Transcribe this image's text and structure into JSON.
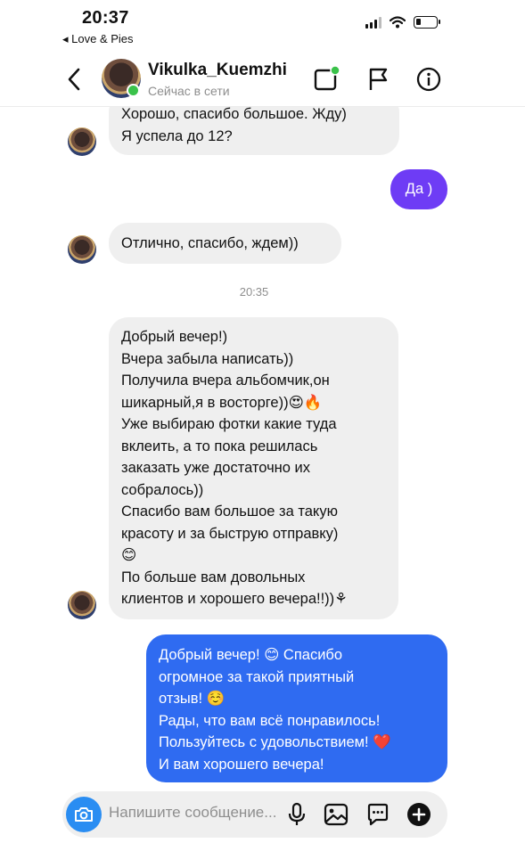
{
  "status_bar": {
    "time": "20:37",
    "back_app": "◂ Love & Pies",
    "icons": [
      "signal-icon",
      "wifi-icon",
      "battery-icon"
    ]
  },
  "header": {
    "username": "Vikulka_Kuemzhi",
    "presence": "Сейчас в сети",
    "icons": [
      "back-chevron-icon",
      "video-call-icon",
      "flag-icon",
      "info-icon"
    ]
  },
  "messages": [
    {
      "direction": "incoming",
      "lines": [
        "Хорошо, спасибо большое.  Жду)",
        "Я успела  до 12?"
      ]
    },
    {
      "direction": "outgoing",
      "lines": [
        "Да )"
      ]
    },
    {
      "direction": "incoming",
      "lines": [
        "Отлично, спасибо, ждем))"
      ]
    },
    {
      "timestamp": "20:35"
    },
    {
      "direction": "incoming",
      "lines": [
        "Добрый вечер!)",
        "Вчера забыла написать))",
        "Получила вчера альбомчик,он",
        "шикарный,я в восторге))😍🔥",
        "Уже выбираю фотки какие туда",
        "вклеить, а то пока решилась",
        "заказать уже  достаточно  их",
        "собралось))",
        "Спасибо  вам большое  за такую",
        "красоту и за быструю отправку)",
        "😊",
        "По больше вам довольных",
        "клиентов  и хорошего вечера!!))⚘"
      ]
    },
    {
      "direction": "outgoing",
      "lines": [
        "Добрый вечер! 😊 Спасибо",
        "огромное за такой приятный",
        "отзыв! ☺️",
        "Рады, что вам всё понравилось!",
        "Пользуйтесь с удовольствием! ❤️",
        "И вам хорошего вечера!"
      ]
    }
  ],
  "composer": {
    "placeholder": "Напишите сообщение...",
    "icons": [
      "camera-icon",
      "microphone-icon",
      "gallery-icon",
      "sticker-icon",
      "plus-icon"
    ]
  },
  "colors": {
    "incoming_bubble": "#efefef",
    "outgoing_bubble_purple": "#6e3cf5",
    "outgoing_bubble_blue": "#2f6bf1",
    "online": "#3ac24a",
    "camera_button": "#2a8df2"
  }
}
